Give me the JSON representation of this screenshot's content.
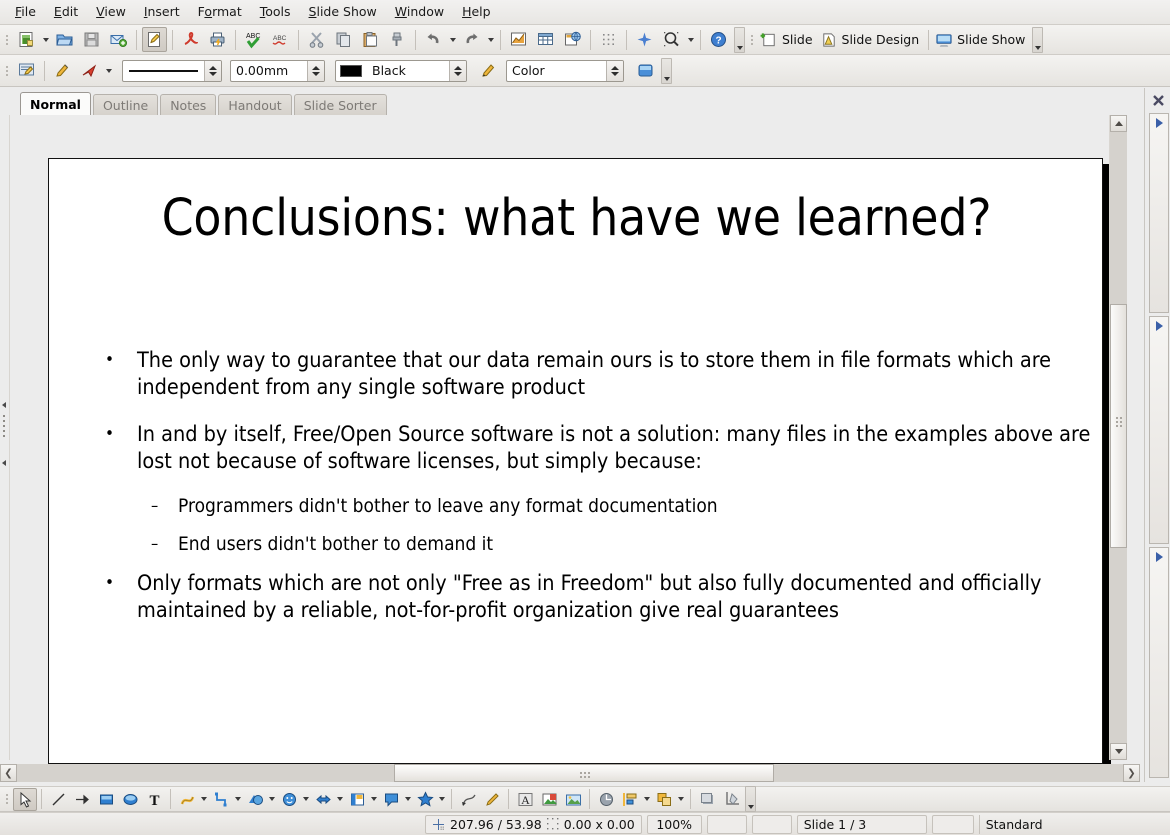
{
  "window": {
    "app": "Impress"
  },
  "menubar": {
    "items": [
      {
        "label": "File",
        "accel": "F"
      },
      {
        "label": "Edit",
        "accel": "E"
      },
      {
        "label": "View",
        "accel": "V"
      },
      {
        "label": "Insert",
        "accel": "I"
      },
      {
        "label": "Format",
        "accel": "o"
      },
      {
        "label": "Tools",
        "accel": "T"
      },
      {
        "label": "Slide Show",
        "accel": "S"
      },
      {
        "label": "Window",
        "accel": "W"
      },
      {
        "label": "Help",
        "accel": "H"
      }
    ]
  },
  "standard_toolbar": {
    "buttons": [
      {
        "name": "new-document-icon",
        "tip": "New"
      },
      {
        "name": "open-document-icon",
        "tip": "Open"
      },
      {
        "name": "save-document-icon",
        "tip": "Save"
      },
      {
        "name": "email-document-icon",
        "tip": "E-mail Document"
      },
      {
        "name": "edit-file-icon",
        "tip": "Edit File",
        "active": true
      },
      {
        "name": "export-pdf-icon",
        "tip": "Export as PDF"
      },
      {
        "name": "print-file-icon",
        "tip": "Print File Directly"
      },
      {
        "name": "spelling-icon",
        "tip": "Spelling and Grammar"
      },
      {
        "name": "autospellcheck-icon",
        "tip": "AutoSpellcheck"
      },
      {
        "name": "cut-icon",
        "tip": "Cut"
      },
      {
        "name": "copy-icon",
        "tip": "Copy"
      },
      {
        "name": "paste-icon",
        "tip": "Paste"
      },
      {
        "name": "clone-formatting-icon",
        "tip": "Clone Formatting"
      },
      {
        "name": "undo-icon",
        "tip": "Undo"
      },
      {
        "name": "redo-icon",
        "tip": "Redo"
      },
      {
        "name": "insert-chart-icon",
        "tip": "Chart"
      },
      {
        "name": "insert-table-icon",
        "tip": "Table"
      },
      {
        "name": "hyperlink-icon",
        "tip": "Hyperlink"
      },
      {
        "name": "display-grid-icon",
        "tip": "Display Grid"
      },
      {
        "name": "display-views-icon",
        "tip": "Display Views"
      },
      {
        "name": "zoom-icon",
        "tip": "Zoom"
      },
      {
        "name": "help-icon",
        "tip": "Help"
      }
    ],
    "text_buttons": [
      {
        "label": "Slide",
        "icon": "new-slide-icon"
      },
      {
        "label": "Slide Design",
        "icon": "slide-design-icon"
      },
      {
        "label": "Slide Show",
        "icon": "slide-show-icon"
      }
    ]
  },
  "line_fill_toolbar": {
    "style_button": "line-style-icon",
    "line_color_button": "line-color-icon",
    "arrow_style_button": "arrow-style-icon",
    "line_style_value": "solid-line",
    "line_width_value": "0.00mm",
    "line_color_value": "Black",
    "line_color_hex": "#000000",
    "area_style_value": "Color",
    "area_color_button": "area-fill-color-icon",
    "shadow_button": "shadow-icon"
  },
  "view_tabs": {
    "items": [
      {
        "label": "Normal",
        "active": true
      },
      {
        "label": "Outline",
        "active": false
      },
      {
        "label": "Notes",
        "active": false
      },
      {
        "label": "Handout",
        "active": false
      },
      {
        "label": "Slide Sorter",
        "active": false
      }
    ]
  },
  "slide": {
    "title": "Conclusions: what have we learned?",
    "bullets": [
      {
        "level": 1,
        "marker": "•",
        "text": "The only way to guarantee that our data remain ours is to store them in file formats which are independent from any single software product"
      },
      {
        "level": 1,
        "marker": "•",
        "text": "In and by itself, Free/Open Source software is not a solution: many files in the examples above are lost not because of software licenses, but simply because:"
      },
      {
        "level": 2,
        "marker": "–",
        "text": "Programmers didn't bother to leave any format documentation"
      },
      {
        "level": 2,
        "marker": "–",
        "text": "End users didn't bother to demand it"
      },
      {
        "level": 1,
        "marker": "•",
        "text": "Only formats which are not only \"Free as in Freedom\" but also fully documented and officially maintained by a reliable, not-for-profit organization give real guarantees"
      }
    ]
  },
  "task_pane": {
    "close_label": "✕",
    "sections": [
      {
        "name": "master-pages-section"
      },
      {
        "name": "layouts-section"
      },
      {
        "name": "custom-animation-section"
      }
    ]
  },
  "drawing_toolbar": {
    "buttons": [
      {
        "name": "select-icon",
        "tip": "Select",
        "active": true
      },
      {
        "name": "line-icon",
        "tip": "Line"
      },
      {
        "name": "line-ends-arrow-icon",
        "tip": "Line Ends with Arrow"
      },
      {
        "name": "rectangle-icon",
        "tip": "Rectangle"
      },
      {
        "name": "ellipse-icon",
        "tip": "Ellipse"
      },
      {
        "name": "text-box-icon",
        "tip": "Insert Text Box"
      },
      {
        "name": "curve-icon",
        "tip": "Curve",
        "caret": true
      },
      {
        "name": "connector-icon",
        "tip": "Connector",
        "caret": true
      },
      {
        "name": "basic-shapes-icon",
        "tip": "Basic Shapes",
        "caret": true
      },
      {
        "name": "symbol-shapes-icon",
        "tip": "Symbol Shapes",
        "caret": true
      },
      {
        "name": "block-arrows-icon",
        "tip": "Block Arrows",
        "caret": true
      },
      {
        "name": "flowchart-icon",
        "tip": "Flowchart",
        "caret": true
      },
      {
        "name": "callouts-icon",
        "tip": "Callouts",
        "caret": true
      },
      {
        "name": "stars-icon",
        "tip": "Stars",
        "caret": true
      },
      {
        "name": "points-icon",
        "tip": "Points"
      },
      {
        "name": "glue-points-icon",
        "tip": "Glue Points"
      },
      {
        "name": "fontwork-icon",
        "tip": "Fontwork Gallery"
      },
      {
        "name": "from-file-icon",
        "tip": "From File"
      },
      {
        "name": "gallery-icon",
        "tip": "Gallery"
      },
      {
        "name": "rotate-icon",
        "tip": "Rotate"
      },
      {
        "name": "align-icon",
        "tip": "Alignment",
        "caret": true
      },
      {
        "name": "arrange-icon",
        "tip": "Arrange",
        "caret": true
      },
      {
        "name": "shadow-icon",
        "tip": "Shadow"
      },
      {
        "name": "crop-image-icon",
        "tip": "Crop Image"
      }
    ]
  },
  "statusbar": {
    "cursor_position": "207.96 / 53.98",
    "object_size": "0.00 x 0.00",
    "zoom": "100%",
    "slide_indicator": "Slide 1 / 3",
    "master_name": "Standard"
  }
}
